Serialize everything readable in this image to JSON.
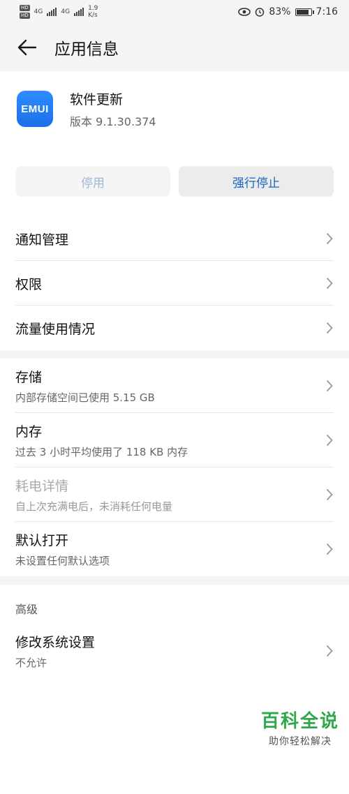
{
  "status_bar": {
    "sim1": "HD",
    "sim2": "HD",
    "net1": "4G",
    "net2": "4G",
    "speed_value": "1.9",
    "speed_unit": "K/s",
    "battery": "83%",
    "time": "7:16"
  },
  "app_bar": {
    "title": "应用信息"
  },
  "app": {
    "icon_text": "EMUI",
    "name": "软件更新",
    "version": "版本 9.1.30.374"
  },
  "buttons": {
    "disable_label": "停用",
    "force_stop_label": "强行停止"
  },
  "section1": {
    "items": [
      {
        "title": "通知管理"
      },
      {
        "title": "权限"
      },
      {
        "title": "流量使用情况"
      }
    ]
  },
  "section2": {
    "items": [
      {
        "title": "存储",
        "subtitle": "内部存储空间已使用 5.15 GB"
      },
      {
        "title": "内存",
        "subtitle": "过去 3 小时平均使用了 118 KB 内存"
      },
      {
        "title": "耗电详情",
        "subtitle": "自上次充满电后，未消耗任何电量"
      },
      {
        "title": "默认打开",
        "subtitle": "未设置任何默认选项"
      }
    ]
  },
  "advanced": {
    "label": "高级",
    "items": [
      {
        "title": "修改系统设置",
        "subtitle": "不允许"
      }
    ]
  },
  "watermark": {
    "main": "百科全说",
    "sub": "助你轻松解决"
  },
  "colors": {
    "accent": "#1565c0",
    "disabled_text": "#9fb8d8",
    "watermark_green": "#2ea84a"
  }
}
